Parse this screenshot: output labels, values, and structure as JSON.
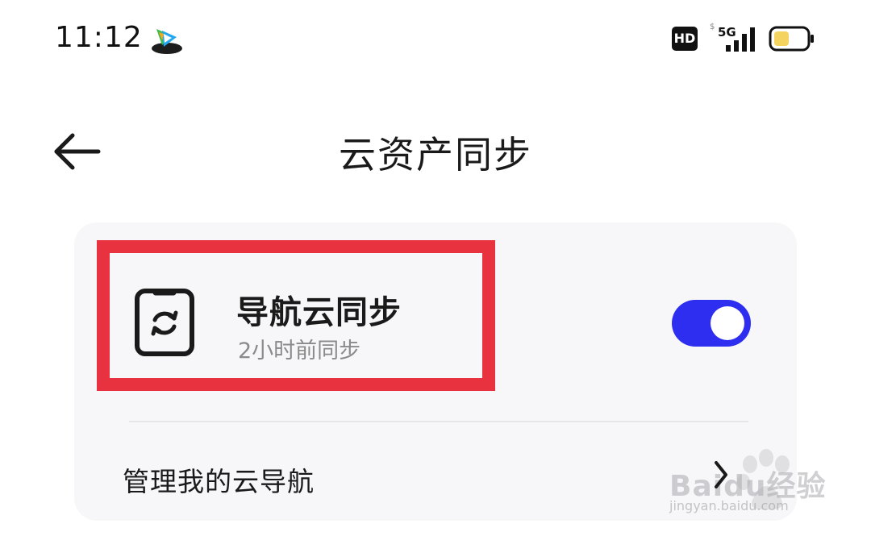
{
  "status_bar": {
    "time": "11:12",
    "app_icon_name": "tencent-video-icon",
    "hd_label": "HD",
    "network_label": "5G",
    "battery_icon_name": "battery-icon"
  },
  "header": {
    "back_icon_name": "arrow-left-icon",
    "title": "云资产同步"
  },
  "sync_item": {
    "icon_name": "phone-sync-icon",
    "title": "导航云同步",
    "subtitle": "2小时前同步",
    "toggle_on": true
  },
  "manage_item": {
    "label": "管理我的云导航",
    "chevron_icon_name": "chevron-right-icon"
  },
  "watermark": {
    "brand": "Baidu经验",
    "url": "jingyan.baidu.com"
  },
  "colors": {
    "accent": "#2d2ef0",
    "highlight": "#e8323f",
    "card_bg": "#f7f7f9",
    "subtitle": "#8a8a8a"
  }
}
